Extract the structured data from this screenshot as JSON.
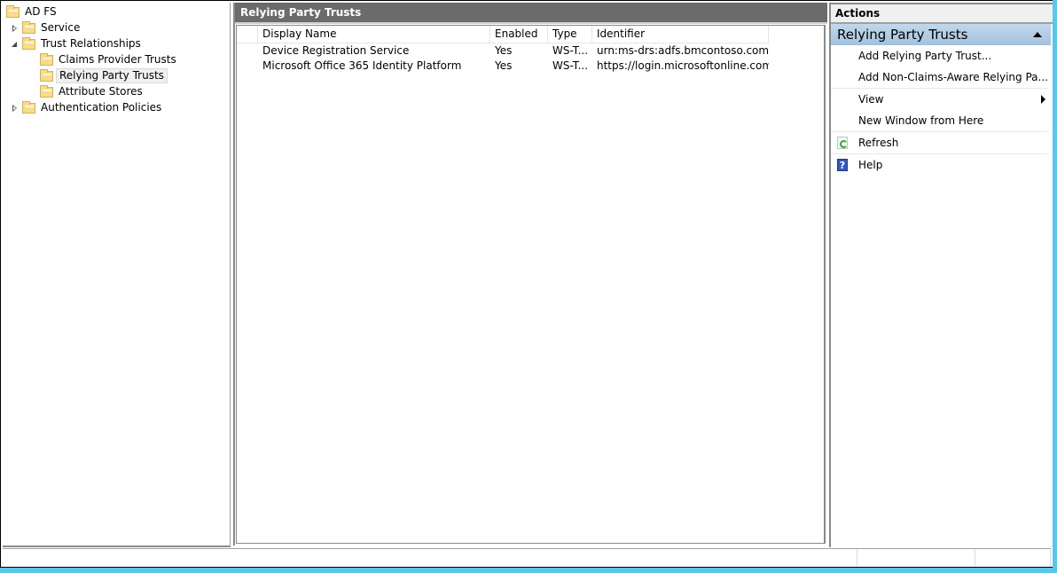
{
  "tree": {
    "items": [
      {
        "label": "AD FS",
        "expander": "none",
        "selected": false
      },
      {
        "label": "Service",
        "expander": "collapsed",
        "selected": false
      },
      {
        "label": "Trust Relationships",
        "expander": "expanded",
        "selected": false
      },
      {
        "label": "Claims Provider Trusts",
        "expander": "none",
        "selected": false
      },
      {
        "label": "Relying Party Trusts",
        "expander": "none",
        "selected": true
      },
      {
        "label": "Attribute Stores",
        "expander": "none",
        "selected": false
      },
      {
        "label": "Authentication Policies",
        "expander": "collapsed",
        "selected": false
      }
    ]
  },
  "center": {
    "title": "Relying Party Trusts",
    "columns": [
      "Display Name",
      "Enabled",
      "Type",
      "Identifier"
    ],
    "rows": [
      {
        "name": "Device Registration Service",
        "enabled": "Yes",
        "type": "WS-T...",
        "identifier": "urn:ms-drs:adfs.bmcontoso.com"
      },
      {
        "name": "Microsoft Office 365 Identity Platform",
        "enabled": "Yes",
        "type": "WS-T...",
        "identifier": "https://login.microsoftonline.com/ext..."
      }
    ]
  },
  "actions": {
    "title": "Actions",
    "section": "Relying Party Trusts",
    "items": [
      {
        "label": "Add Relying Party Trust...",
        "icon": null
      },
      {
        "label": "Add Non-Claims-Aware Relying Pa...",
        "icon": null
      },
      {
        "label": "View",
        "icon": null,
        "submenu": true
      },
      {
        "label": "New Window from Here",
        "icon": null
      },
      {
        "label": "Refresh",
        "icon": "refresh-icon"
      },
      {
        "label": "Help",
        "icon": "help-icon",
        "glyph": "?"
      }
    ]
  },
  "colors": {
    "header_bg": "#6b6b6b",
    "section_bg": "#b3cce5",
    "taskbar_accent": "#5bc6ea"
  }
}
